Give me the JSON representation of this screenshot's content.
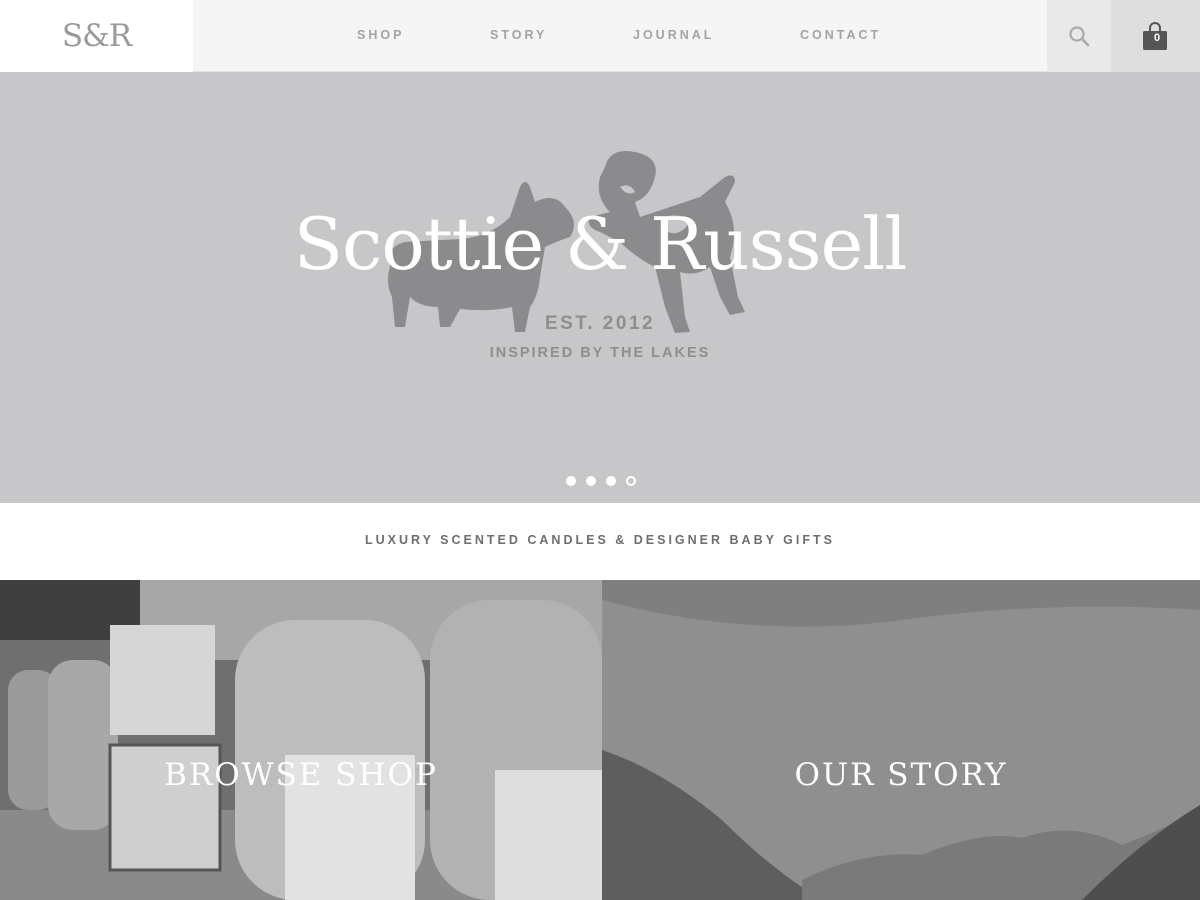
{
  "header": {
    "logo": "S&R",
    "nav": [
      {
        "label": "SHOP"
      },
      {
        "label": "STORY"
      },
      {
        "label": "JOURNAL"
      },
      {
        "label": "CONTACT"
      }
    ],
    "search_icon": "search-icon",
    "cart_icon": "shopping-bag-icon",
    "cart_count": "0"
  },
  "hero": {
    "title": "Scottie & Russell",
    "est": "EST. 2012",
    "tagline": "INSPIRED BY THE LAKES",
    "slides": 4,
    "active_slide": 4
  },
  "strip": {
    "text": "LUXURY SCENTED CANDLES & DESIGNER BABY GIFTS"
  },
  "panels": [
    {
      "label": "BROWSE SHOP"
    },
    {
      "label": "OUR STORY"
    }
  ],
  "colors": {
    "hero_bg": "#c7c7c9",
    "header_bg": "#f5f5f5",
    "nav_text": "#a3a3a3",
    "cart_bg": "#dedede"
  }
}
